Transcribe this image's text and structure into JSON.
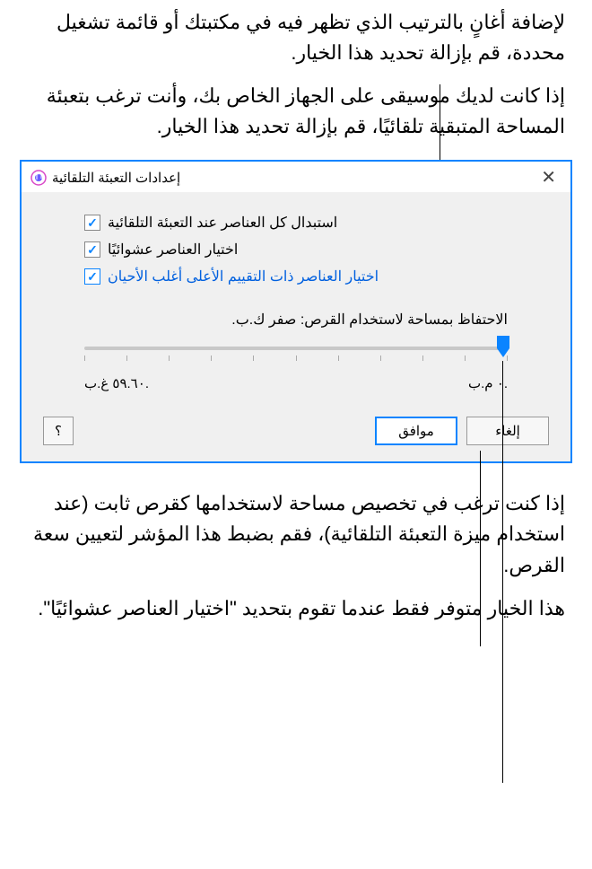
{
  "annotations": {
    "top1": "لإضافة أغانٍ بالترتيب الذي تظهر فيه في مكتبتك أو قائمة تشغيل محددة، قم بإزالة تحديد هذا الخيار.",
    "top2": "إذا كانت لديك موسيقى على الجهاز الخاص بك، وأنت ترغب بتعبئة المساحة المتبقية تلقائيًا، قم بإزالة تحديد هذا الخيار.",
    "bottom1": "إذا كنت ترغب في تخصيص مساحة لاستخدامها كقرص ثابت (عند استخدام ميزة التعبئة التلقائية)، فقم بضبط هذا المؤشر لتعيين سعة القرص.",
    "bottom2": "هذا الخيار متوفر فقط عندما تقوم بتحديد \"اختيار العناصر عشوائيًا\"."
  },
  "dialog": {
    "title": "إعدادات التعبئة التلقائية",
    "checkbox1": "استبدال كل العناصر عند التعبئة التلقائية",
    "checkbox2": "اختيار العناصر عشوائيًا",
    "checkbox3": "اختيار العناصر ذات التقييم الأعلى أغلب الأحيان",
    "reserve_label": "الاحتفاظ بمساحة لاستخدام القرص: صفر ك.ب.",
    "scale_right": "٠ م.ب.",
    "scale_left": "٥٩.٦٠ غ.ب.",
    "ok": "موافق",
    "cancel": "إلغاء",
    "help": "؟"
  }
}
